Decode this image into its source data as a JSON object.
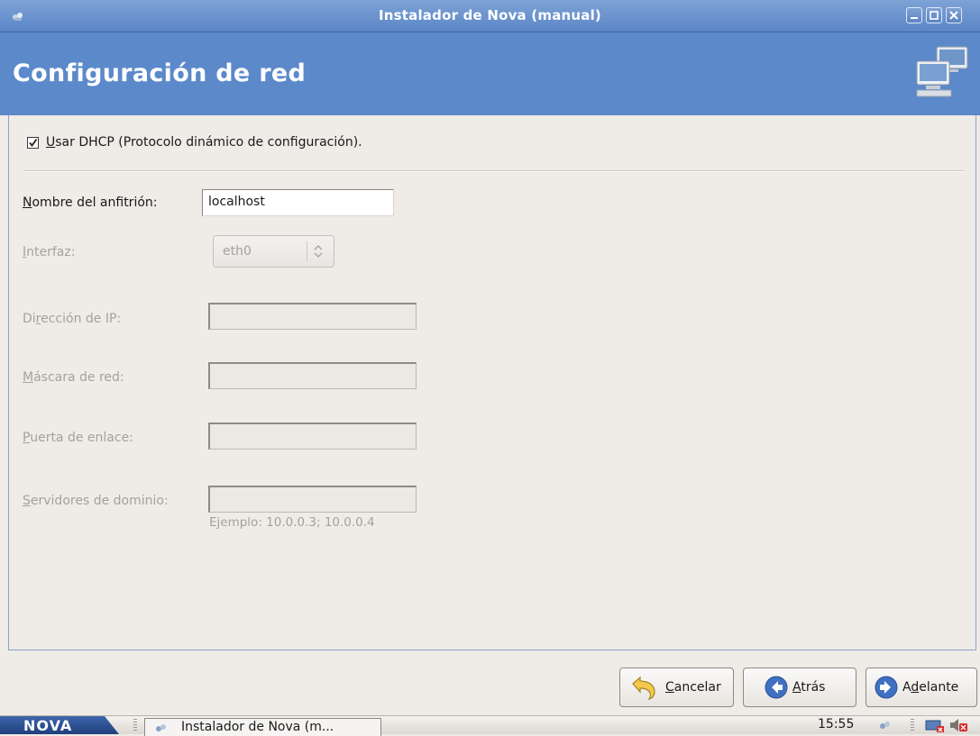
{
  "window": {
    "title": "Instalador de Nova (manual)"
  },
  "header": {
    "title": "Configuración de red"
  },
  "dhcp": {
    "checked": true,
    "label_mnemonic": "U",
    "label_rest": "sar DHCP (Protocolo dinámico de configuración)."
  },
  "hostname": {
    "label_mnemonic": "N",
    "label_rest": "ombre del anfitrión:",
    "value": "localhost"
  },
  "interface": {
    "label_mnemonic": "I",
    "label_rest": "nterfaz:",
    "value": "eth0"
  },
  "ip": {
    "label_pre": "Di",
    "label_mnemonic": "r",
    "label_rest": "ección de IP:"
  },
  "netmask": {
    "label_mnemonic": "M",
    "label_rest": "áscara de red:"
  },
  "gateway": {
    "label_mnemonic": "P",
    "label_rest": "uerta de enlace:"
  },
  "dns": {
    "label_mnemonic": "S",
    "label_rest": "ervidores de dominio:",
    "hint": "Ejemplo: 10.0.0.3; 10.0.0.4"
  },
  "buttons": {
    "cancel_mnemonic": "C",
    "cancel_rest": "ancelar",
    "back_mnemonic": "A",
    "back_rest": "trás",
    "next_pre": "A",
    "next_mnemonic": "d",
    "next_rest": "elante"
  },
  "taskbar": {
    "brand": "NOVA",
    "task_label": "Instalador de Nova (m...",
    "clock": "15:55"
  },
  "colors": {
    "titlebar": "#5a86c6",
    "header": "#5b89ca",
    "window_bg": "#efebe7",
    "disabled_text": "#a5a19c"
  }
}
